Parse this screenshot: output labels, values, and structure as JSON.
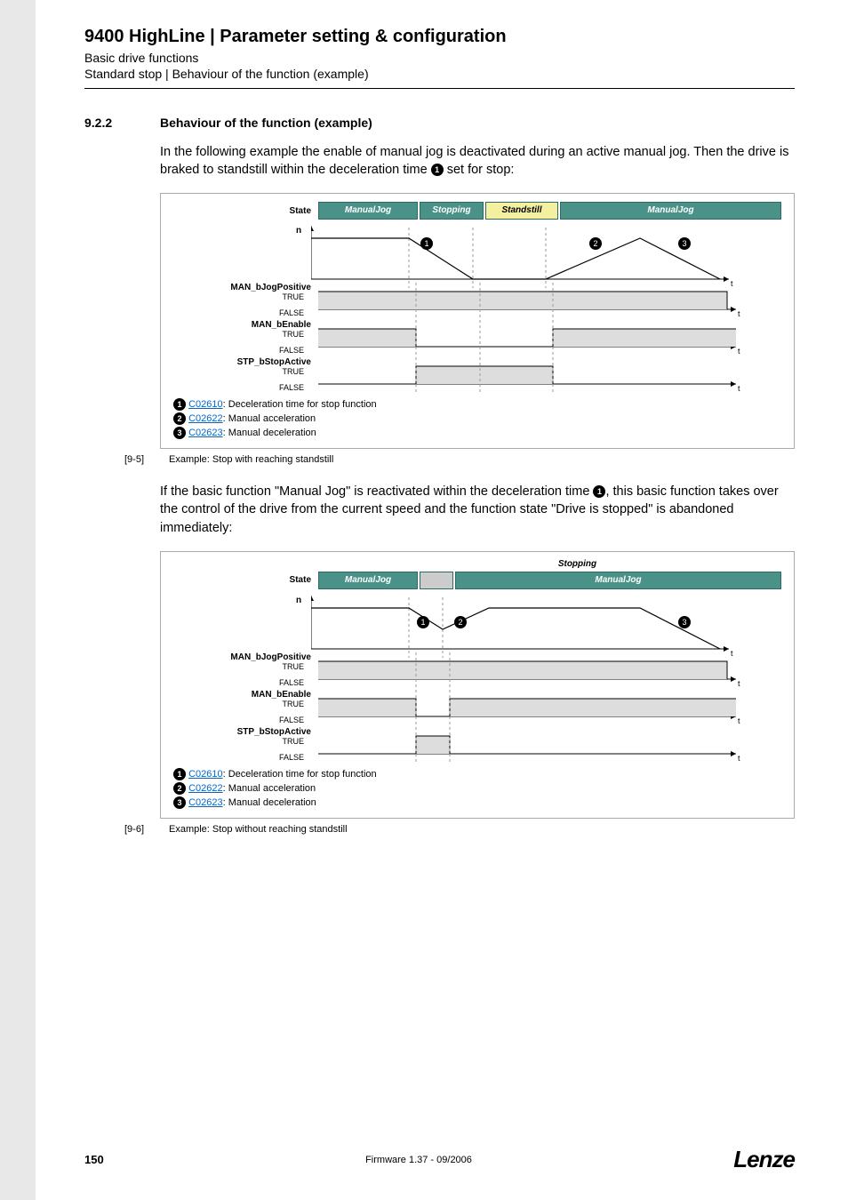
{
  "header": {
    "title": "9400 HighLine | Parameter setting & configuration",
    "sub1": "Basic drive functions",
    "sub2": "Standard stop | Behaviour of the function (example)"
  },
  "section": {
    "num": "9.2.2",
    "title": "Behaviour of the function (example)"
  },
  "para1a": "In the following example the enable of manual jog is deactivated during an active manual jog. Then the drive is braked to standstill within the deceleration time ",
  "para1b": " set for stop:",
  "diagram1": {
    "stateLabel": "State",
    "nLabel": "n",
    "states": [
      "ManualJog",
      "Stopping",
      "Standstill",
      "ManualJog"
    ],
    "signals": [
      {
        "name": "MAN_bJogPositive",
        "true": "TRUE",
        "false": "FALSE"
      },
      {
        "name": "MAN_bEnable",
        "true": "TRUE",
        "false": "FALSE"
      },
      {
        "name": "STP_bStopActive",
        "true": "TRUE",
        "false": "FALSE"
      }
    ],
    "t": "t"
  },
  "legend": [
    {
      "num": "1",
      "code": "C02610",
      "text": ": Deceleration time for stop function"
    },
    {
      "num": "2",
      "code": "C02622",
      "text": ": Manual acceleration"
    },
    {
      "num": "3",
      "code": "C02623",
      "text": ": Manual deceleration"
    }
  ],
  "fig1": {
    "num": "[9-5]",
    "caption": "Example: Stop with reaching standstill"
  },
  "para2a": "If the basic function \"Manual Jog\" is reactivated within the deceleration time ",
  "para2b": ", this basic function takes over the control of the drive from the current speed and the function state \"Drive is stopped\" is abandoned immediately:",
  "diagram2": {
    "stoppingHeader": "Stopping",
    "stateLabel": "State",
    "nLabel": "n",
    "states": [
      "ManualJog",
      "ManualJog"
    ]
  },
  "fig2": {
    "num": "[9-6]",
    "caption": "Example: Stop without reaching standstill"
  },
  "footer": {
    "page": "150",
    "mid": "Firmware 1.37 - 09/2006",
    "logo": "Lenze"
  },
  "chart_data": [
    {
      "type": "line",
      "title": "State/signal timing — Stop with reaching standstill",
      "series": [
        {
          "name": "State",
          "type": "step-categorical",
          "segments": [
            "ManualJog",
            "Stopping",
            "Standstill",
            "ManualJog"
          ]
        },
        {
          "name": "n (speed)",
          "type": "piecewise",
          "notes": "flat at nominal, ramp to 0 during Stopping (C02610), hold 0 during Standstill, ramp up (C02622) then down (C02623) during second ManualJog"
        },
        {
          "name": "MAN_bJogPositive",
          "type": "boolean-step",
          "levels": [
            "TRUE",
            "TRUE",
            "TRUE",
            "TRUE→FALSE at end"
          ]
        },
        {
          "name": "MAN_bEnable",
          "type": "boolean-step",
          "levels": [
            "TRUE",
            "FALSE",
            "FALSE",
            "TRUE"
          ]
        },
        {
          "name": "STP_bStopActive",
          "type": "boolean-step",
          "levels": [
            "FALSE",
            "TRUE",
            "TRUE→FALSE",
            "FALSE"
          ]
        }
      ],
      "annotations": [
        "1: C02610 deceleration",
        "2: C02622 acceleration",
        "3: C02623 deceleration"
      ]
    },
    {
      "type": "line",
      "title": "State/signal timing — Stop without reaching standstill",
      "series": [
        {
          "name": "State",
          "type": "step-categorical",
          "segments": [
            "ManualJog",
            "Stopping",
            "ManualJog"
          ]
        },
        {
          "name": "n (speed)",
          "type": "piecewise",
          "notes": "flat, partial ramp down (C02610), ramp back up (C02622), flat, ramp down (C02623)"
        },
        {
          "name": "MAN_bJogPositive",
          "type": "boolean-step",
          "levels": [
            "TRUE",
            "TRUE",
            "TRUE→FALSE at end"
          ]
        },
        {
          "name": "MAN_bEnable",
          "type": "boolean-step",
          "levels": [
            "TRUE",
            "FALSE",
            "TRUE"
          ]
        },
        {
          "name": "STP_bStopActive",
          "type": "boolean-step",
          "levels": [
            "FALSE",
            "TRUE",
            "FALSE"
          ]
        }
      ],
      "annotations": [
        "1: C02610 deceleration",
        "2: C02622 acceleration",
        "3: C02623 deceleration"
      ]
    }
  ]
}
